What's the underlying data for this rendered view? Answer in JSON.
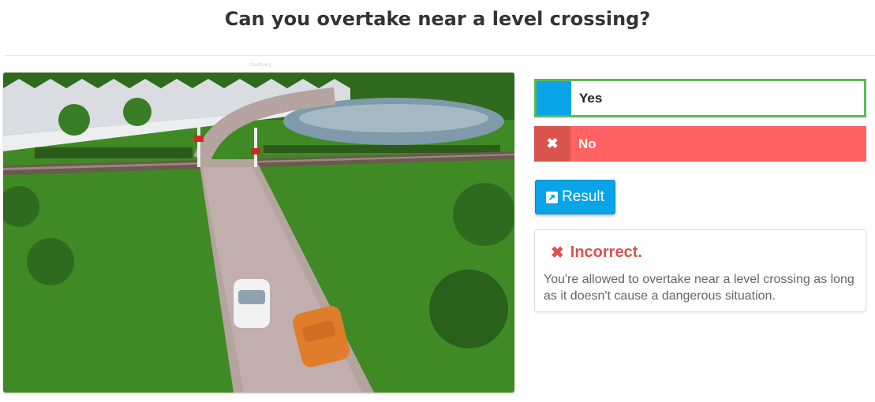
{
  "page": {
    "title": "Can you overtake near a level crossing?",
    "image_credit": "Credit.png"
  },
  "answers": [
    {
      "label": "Yes",
      "state": "selected",
      "marker_color": "#0aa4e8"
    },
    {
      "label": "No",
      "icon": "close-icon",
      "marker_glyph": "✖",
      "color": "#ff6262"
    }
  ],
  "result_button": {
    "label": "Result",
    "icon": "external-link-icon"
  },
  "feedback": {
    "heading": "Incorrect.",
    "icon": "close-icon",
    "icon_glyph": "✖",
    "message": "You're allowed to overtake near a level crossing as long as it doesn't cause a dangerous situation.",
    "color": "#d9534f"
  },
  "colors": {
    "accent_blue": "#0aa4e8",
    "correct_border": "#5cb85c",
    "wrong_red": "#ff6262"
  }
}
